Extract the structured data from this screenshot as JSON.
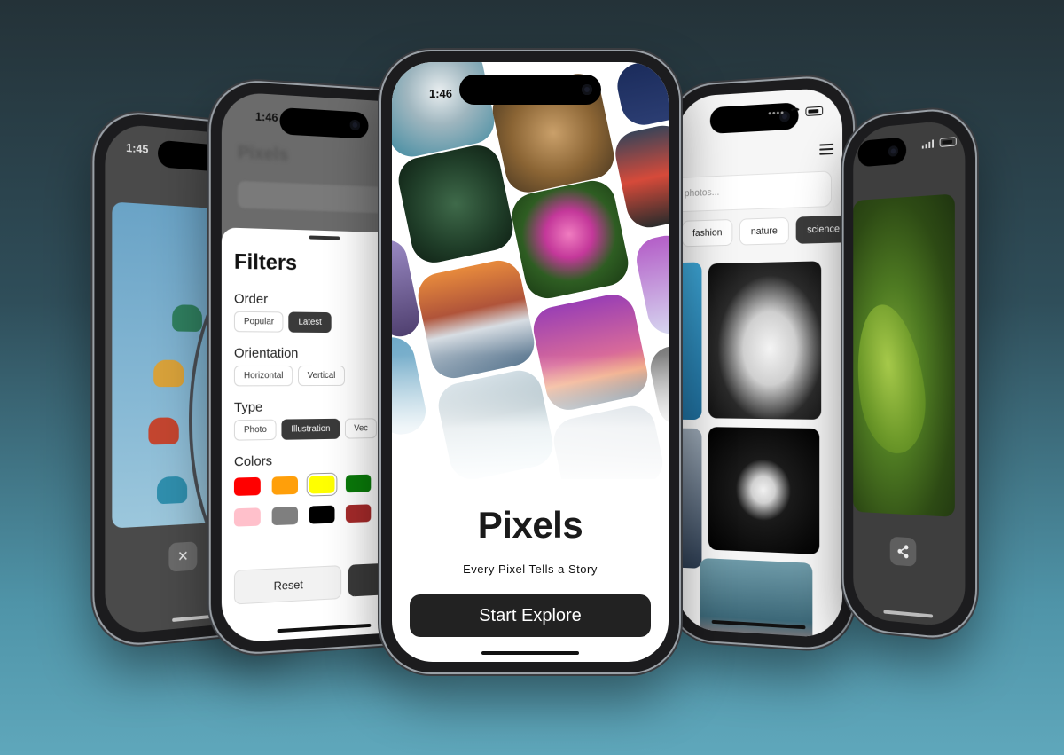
{
  "status": {
    "phone1_time": "1:45",
    "phone2_time": "1:46",
    "phone3_time": "1:46"
  },
  "filters": {
    "title": "Filters",
    "order": {
      "label": "Order",
      "options": [
        "Popular",
        "Latest"
      ],
      "selected": "Latest"
    },
    "orientation": {
      "label": "Orientation",
      "options": [
        "Horizontal",
        "Vertical"
      ]
    },
    "type": {
      "label": "Type",
      "options": [
        "Photo",
        "Illustration",
        "Vec"
      ],
      "selected": "Illustration"
    },
    "colors": {
      "label": "Colors",
      "swatches": [
        "#ff0000",
        "#ff9f0a",
        "#ffff00",
        "#0a7a0a",
        "#ffc0cb",
        "#7f7f7f",
        "#000000",
        "#a52a2a"
      ],
      "selected": "#ffff00"
    },
    "reset_label": "Reset"
  },
  "welcome": {
    "title": "Pixels",
    "tagline": "Every Pixel Tells a Story",
    "cta_label": "Start Explore"
  },
  "browse": {
    "search_placeholder": "photos...",
    "tags": [
      "fashion",
      "nature",
      "science"
    ],
    "selected_tag": "science"
  },
  "viewer": {
    "close_icon": "close-icon",
    "share_icon": "share-icon"
  }
}
